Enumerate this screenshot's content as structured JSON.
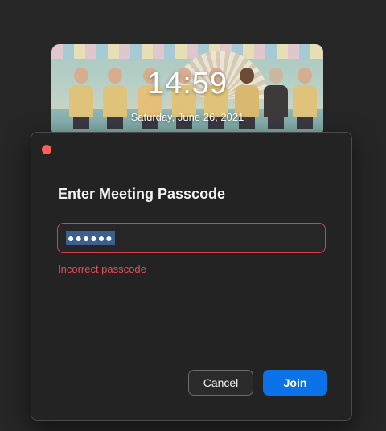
{
  "lockscreen": {
    "time": "14:59",
    "date": "Saturday, June 26, 2021"
  },
  "dialog": {
    "title": "Enter Meeting Passcode",
    "passcode_value": "●●●●●●",
    "error_text": "Incorrect passcode",
    "cancel_label": "Cancel",
    "join_label": "Join"
  },
  "colors": {
    "background": "#262626",
    "dialog_bg": "#232323",
    "close_dot": "#fe5f57",
    "field_error_border": "#d8414c",
    "error_text": "#e2505a",
    "selection": "#3d5f8c",
    "join_button": "#0b72e7"
  }
}
